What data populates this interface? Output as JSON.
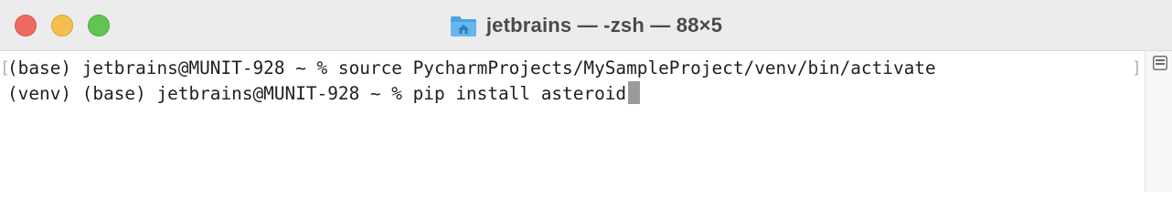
{
  "window": {
    "title": "jetbrains — -zsh — 88×5",
    "title_icon": "folder-home-icon"
  },
  "terminal": {
    "lines": [
      "(base) jetbrains@MUNIT-928 ~ % source PycharmProjects/MySampleProject/venv/bin/activate",
      "(venv) (base) jetbrains@MUNIT-928 ~ % pip install asteroid"
    ],
    "marks_button_icon": "marks-list-icon"
  },
  "colors": {
    "titlebar": "#ececec",
    "close": "#ed6a5e",
    "minimize": "#f5bf4f",
    "maximize": "#61c554",
    "text": "#1f1f1f",
    "cursor": "#9b9b9b"
  }
}
